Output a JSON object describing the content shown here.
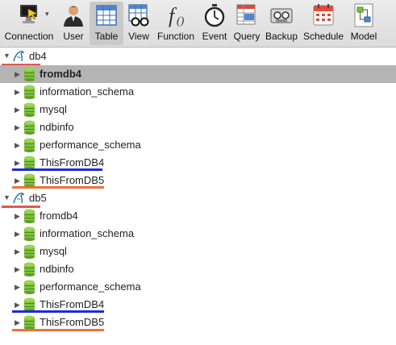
{
  "toolbar": {
    "buttons": [
      {
        "label": "Connection",
        "icon": "connection-icon"
      },
      {
        "label": "User",
        "icon": "user-icon"
      },
      {
        "label": "Table",
        "icon": "table-icon",
        "active": true
      },
      {
        "label": "View",
        "icon": "view-icon"
      },
      {
        "label": "Function",
        "icon": "function-icon"
      },
      {
        "label": "Event",
        "icon": "event-icon"
      },
      {
        "label": "Query",
        "icon": "query-icon"
      },
      {
        "label": "Backup",
        "icon": "backup-icon"
      },
      {
        "label": "Schedule",
        "icon": "schedule-icon"
      },
      {
        "label": "Model",
        "icon": "model-icon"
      }
    ]
  },
  "tree": {
    "connections": [
      {
        "name": "db4",
        "databases": [
          "fromdb4",
          "information_schema",
          "mysql",
          "ndbinfo",
          "performance_schema",
          "ThisFromDB4",
          "ThisFromDB5"
        ]
      },
      {
        "name": "db5",
        "databases": [
          "fromdb4",
          "information_schema",
          "mysql",
          "ndbinfo",
          "performance_schema",
          "ThisFromDB4",
          "ThisFromDB5"
        ]
      }
    ],
    "selected": "db4/fromdb4"
  },
  "colors": {
    "connection_underline": "#e05757",
    "db4_underline": "#1e2bd8",
    "db5_underline": "#f0703a",
    "selection": "#b4b4b4",
    "db_icon_green": "#7cc23b"
  }
}
